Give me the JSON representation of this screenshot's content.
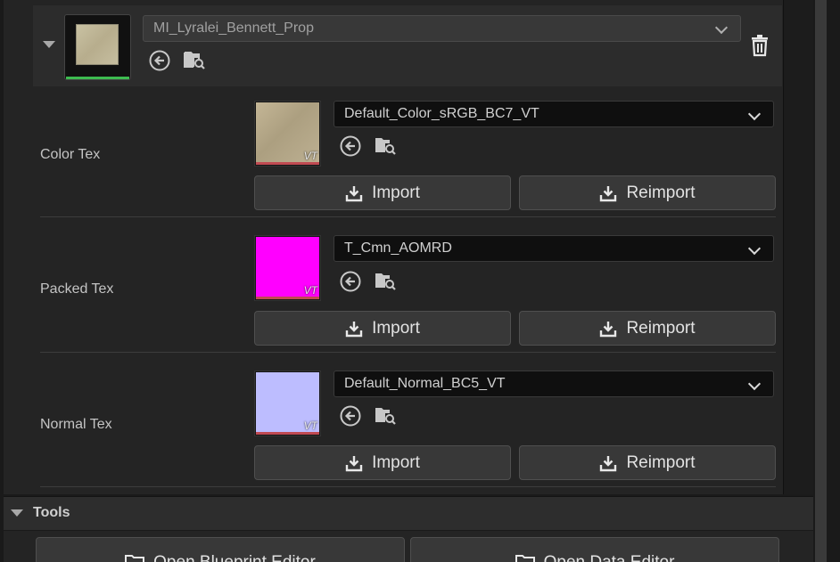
{
  "material": {
    "name": "MI_Lyralei_Bennett_Prop"
  },
  "rows": [
    {
      "label": "Color Tex",
      "texture": "Default_Color_sRGB_BC7_VT",
      "badge": "VT",
      "thumb_color": "#b8ab8b",
      "import_label": "Import",
      "reimport_label": "Reimport"
    },
    {
      "label": "Packed Tex",
      "texture": "T_Cmn_AOMRD",
      "badge": "VT",
      "thumb_color": "#ff00ff",
      "import_label": "Import",
      "reimport_label": "Reimport"
    },
    {
      "label": "Normal Tex",
      "texture": "Default_Normal_BC5_VT",
      "badge": "VT",
      "thumb_color": "#bdbdff",
      "import_label": "Import",
      "reimport_label": "Reimport"
    }
  ],
  "tools": {
    "label": "Tools",
    "buttons": [
      {
        "label": "Open Blueprint Editor"
      },
      {
        "label": "Open Data Editor"
      }
    ]
  },
  "icons": {
    "use-selected": "arrow-left-circle-icon",
    "browse": "folder-search-icon",
    "delete": "trash-icon",
    "import": "download-tray-icon",
    "folder": "folder-icon"
  },
  "colors": {
    "material_underline": "#3dbb50",
    "texture_underline": "#c04a52"
  }
}
